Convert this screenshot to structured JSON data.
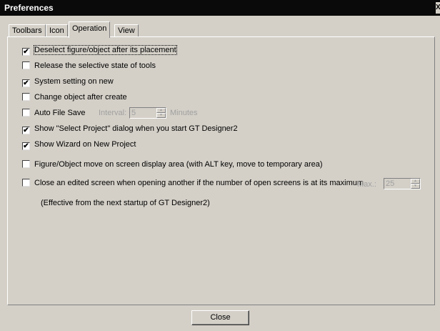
{
  "window": {
    "title": "Preferences",
    "close_glyph": "X"
  },
  "tabs": [
    {
      "label": "Toolbars"
    },
    {
      "label": "Icon"
    },
    {
      "label": "Operation"
    },
    {
      "label": "View"
    }
  ],
  "options": {
    "deselect": {
      "label": "Deselect figure/object after its placement",
      "checked": true
    },
    "release": {
      "label": "Release the selective state of tools",
      "checked": false
    },
    "system": {
      "label": "System setting on new",
      "checked": true
    },
    "change": {
      "label": "Change object after create",
      "checked": false
    },
    "autosave": {
      "label": "Auto File Save",
      "checked": false,
      "interval_label": "Interval:",
      "interval_value": "5",
      "interval_unit": "Minutes"
    },
    "select_project": {
      "label": "Show \"Select Project\" dialog when you start GT Designer2",
      "checked": true
    },
    "wizard": {
      "label": "Show Wizard on New Project",
      "checked": true
    },
    "figure_move": {
      "label": "Figure/Object move on screen display area (with ALT key, move to temporary area)",
      "checked": false
    },
    "close_edited": {
      "label": "Close an edited screen when opening another if the number of open screens is at its maximum",
      "checked": false,
      "max_label": "Max.:",
      "max_value": "25"
    }
  },
  "note": "(Effective from the next startup of GT Designer2)",
  "buttons": {
    "close": "Close"
  },
  "check_glyph": "✔"
}
